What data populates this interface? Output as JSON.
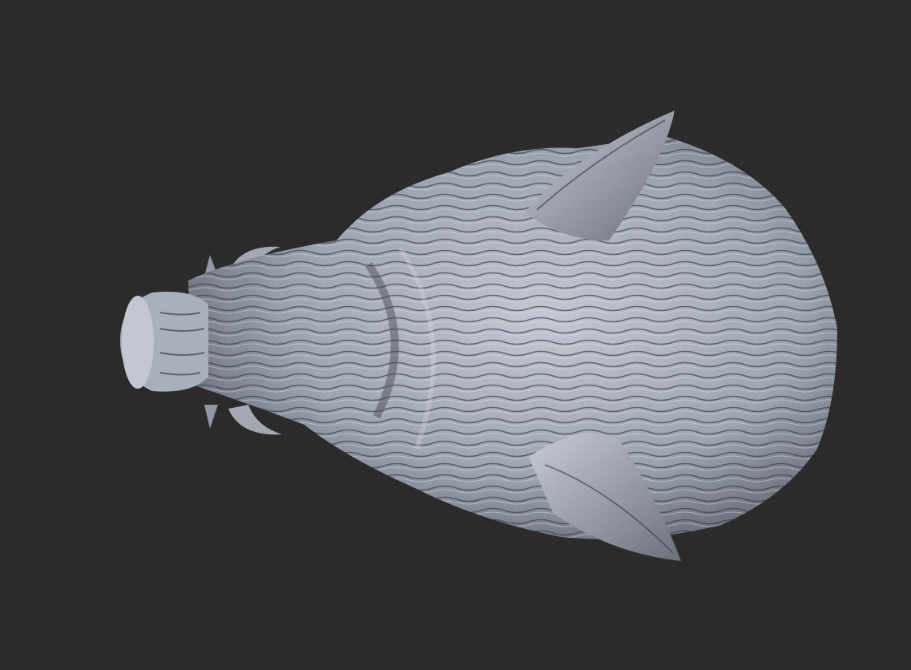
{
  "scene": {
    "subject": "boar-head-sculpt",
    "colors": {
      "background": "#2b2b2b",
      "clay_light": "#b9bec9",
      "clay_mid": "#8d93a0",
      "clay_dark": "#3c404a"
    }
  }
}
